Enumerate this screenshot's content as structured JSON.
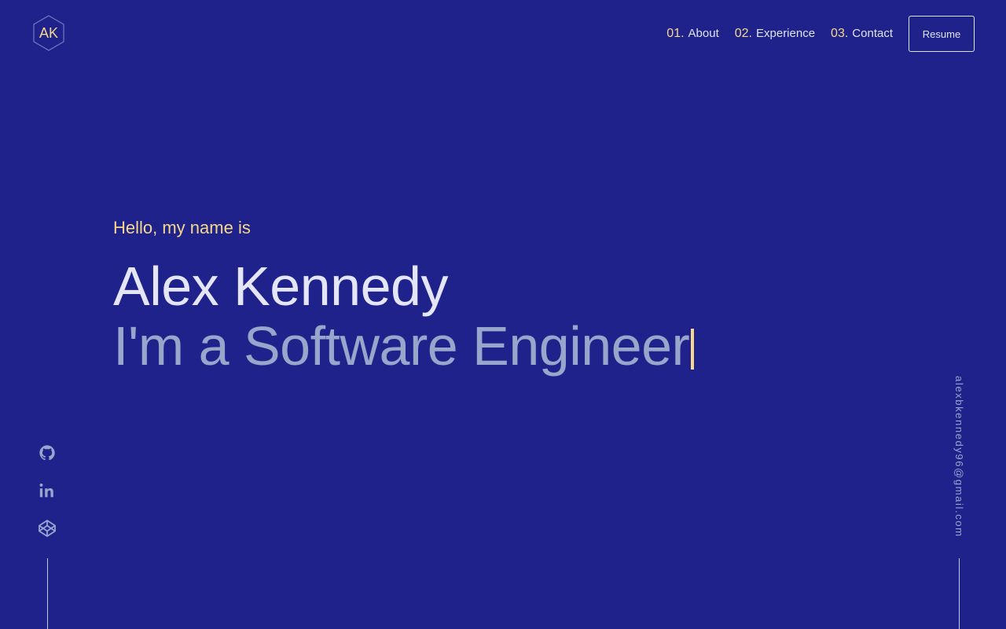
{
  "logo": {
    "initials": "AK",
    "icon": "hexagon-logo-icon"
  },
  "nav": {
    "items": [
      {
        "num": "01.",
        "label": "About"
      },
      {
        "num": "02.",
        "label": "Experience"
      },
      {
        "num": "03.",
        "label": "Contact"
      }
    ],
    "resume_label": "Resume"
  },
  "hero": {
    "greeting": "Hello, my name is",
    "name": "Alex Kennedy",
    "role": "I'm a Software Engineer"
  },
  "social": [
    {
      "icon": "github-icon"
    },
    {
      "icon": "linkedin-icon"
    },
    {
      "icon": "codepen-icon"
    }
  ],
  "email": "alexbkennedy96@gmail.com",
  "colors": {
    "background": "#20228c",
    "accent": "#f5d88a",
    "text_light": "#e4e6f8",
    "text_muted": "#98a6cc"
  }
}
